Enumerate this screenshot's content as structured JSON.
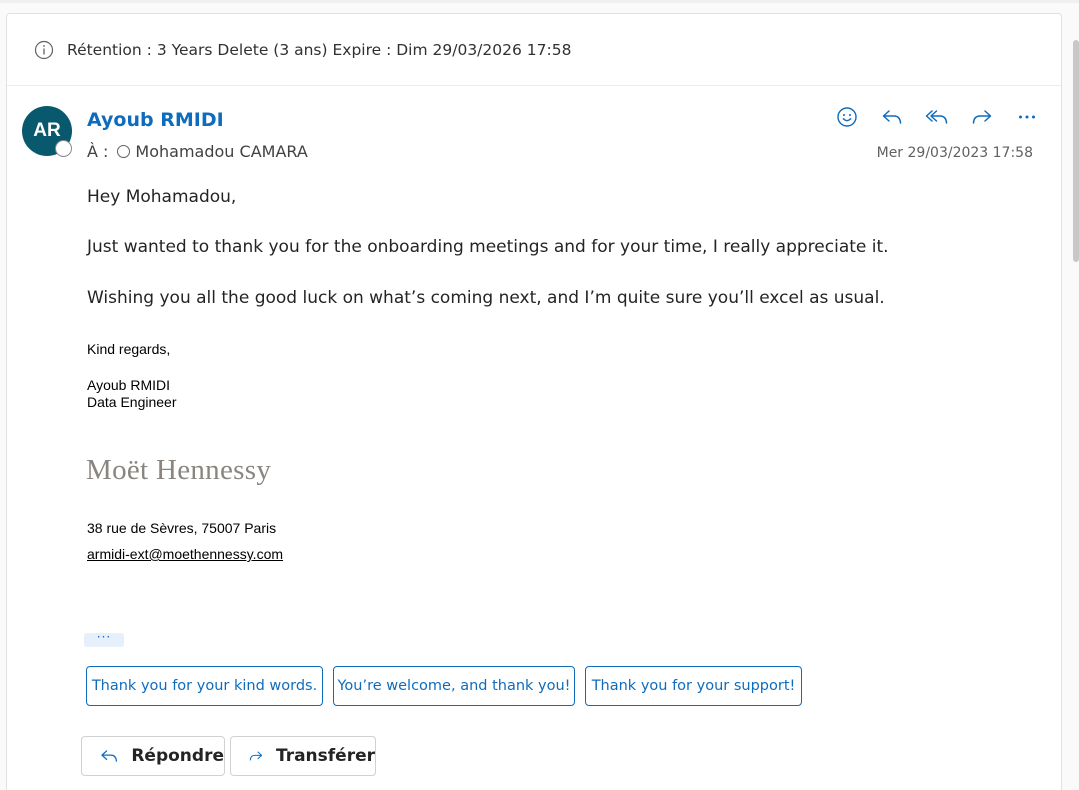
{
  "retention": {
    "text": "Rétention : 3 Years Delete (3 ans) Expire : Dim 29/03/2026 17:58"
  },
  "message": {
    "avatar_initials": "AR",
    "sender_name": "Ayoub RMIDI",
    "to_label": "À :",
    "recipient": "Mohamadou CAMARA",
    "date": "Mer 29/03/2023 17:58",
    "actions": [
      "smile-icon",
      "reply-icon",
      "reply-all-icon",
      "forward-icon",
      "more-icon"
    ],
    "body": {
      "greeting": "Hey Mohamadou,",
      "paragraph1": "Just wanted to thank you for the onboarding meetings and for your time, I really appreciate it.",
      "paragraph2": "Wishing you all the good luck on what’s coming next, and I’m quite sure you’ll excel as usual.",
      "closing": "Kind regards,",
      "sig_name": "Ayoub RMIDI",
      "sig_title": "Data Engineer",
      "logo_text": "Moët Hennessy",
      "address": "38 rue de Sèvres,  75007 Paris",
      "email": "armidi-ext@moethennessy.com"
    },
    "show_more": "···"
  },
  "suggested_replies": [
    "Thank you for your kind words.",
    "You’re welcome, and thank you!",
    "Thank you for your support!"
  ],
  "bottom_actions": {
    "reply_label": "Répondre",
    "forward_label": "Transférer"
  },
  "colors": {
    "accent": "#0f6cbd",
    "avatar": "#08596e",
    "logo": "#8b8580"
  }
}
